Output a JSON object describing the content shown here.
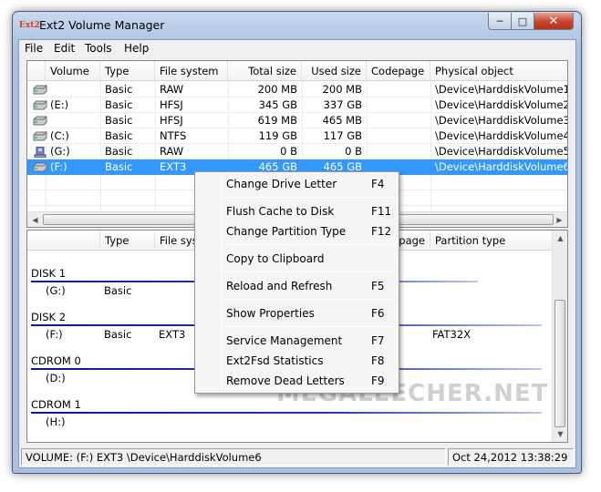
{
  "window": {
    "title": "Ext2 Volume Manager",
    "icon_text": "Ext2"
  },
  "menubar": [
    "File",
    "Edit",
    "Tools",
    "Help"
  ],
  "volume_table": {
    "columns": [
      "Volume",
      "Type",
      "File system",
      "Total size",
      "Used size",
      "Codepage",
      "Physical object"
    ],
    "rows": [
      {
        "volume": "",
        "type": "Basic",
        "fs": "RAW",
        "total": "200 MB",
        "used": "200 MB",
        "codepage": "",
        "physical": "\\Device\\HarddiskVolume1",
        "icon": "hard-drive-icon"
      },
      {
        "volume": "(E:)",
        "type": "Basic",
        "fs": "HFSJ",
        "total": "345 GB",
        "used": "337 GB",
        "codepage": "",
        "physical": "\\Device\\HarddiskVolume2",
        "icon": "hard-drive-icon"
      },
      {
        "volume": "",
        "type": "Basic",
        "fs": "HFSJ",
        "total": "619 MB",
        "used": "465 MB",
        "codepage": "",
        "physical": "\\Device\\HarddiskVolume3",
        "icon": "hard-drive-icon"
      },
      {
        "volume": "(C:)",
        "type": "Basic",
        "fs": "NTFS",
        "total": "119 GB",
        "used": "117 GB",
        "codepage": "",
        "physical": "\\Device\\HarddiskVolume4",
        "icon": "hard-drive-icon"
      },
      {
        "volume": "(G:)",
        "type": "Basic",
        "fs": "RAW",
        "total": "0 B",
        "used": "0 B",
        "codepage": "",
        "physical": "\\Device\\HarddiskVolume5",
        "icon": "usb-drive-icon"
      },
      {
        "volume": "(F:)",
        "type": "Basic",
        "fs": "EXT3",
        "total": "465 GB",
        "used": "465 GB",
        "codepage": "",
        "physical": "\\Device\\HarddiskVolume6",
        "icon": "hard-drive-icon",
        "selected": true
      }
    ]
  },
  "disk_table": {
    "columns": [
      "",
      "Type",
      "File syst",
      "",
      "",
      "page",
      "Partition type"
    ],
    "groups": [
      {
        "label": "DISK 1",
        "rows": [
          {
            "volume": "(G:)",
            "type": "Basic",
            "fs": "",
            "ptype": ""
          }
        ]
      },
      {
        "label": "DISK 2",
        "rows": [
          {
            "volume": "(F:)",
            "type": "Basic",
            "fs": "EXT3",
            "ptype": "FAT32X"
          }
        ]
      },
      {
        "label": "CDROM 0",
        "rows": [
          {
            "volume": "(D:)",
            "type": "",
            "fs": "",
            "ptype": ""
          }
        ]
      },
      {
        "label": "CDROM 1",
        "rows": [
          {
            "volume": "(H:)",
            "type": "",
            "fs": "",
            "ptype": ""
          }
        ]
      }
    ]
  },
  "context_menu": [
    {
      "label": "Change Drive Letter",
      "key": "F4"
    },
    {
      "separator": true
    },
    {
      "label": "Flush Cache to Disk",
      "key": "F11"
    },
    {
      "label": "Change Partition Type",
      "key": "F12"
    },
    {
      "separator": true
    },
    {
      "label": "Copy to Clipboard",
      "key": ""
    },
    {
      "separator": true
    },
    {
      "label": "Reload and Refresh",
      "key": "F5"
    },
    {
      "separator": true
    },
    {
      "label": "Show Properties",
      "key": "F6"
    },
    {
      "separator": true
    },
    {
      "label": "Service Management",
      "key": "F7"
    },
    {
      "label": "Ext2Fsd Statistics",
      "key": "F8"
    },
    {
      "label": "Remove Dead Letters",
      "key": "F9"
    }
  ],
  "statusbar": {
    "volume_info": "VOLUME: (F:) EXT3 \\Device\\HarddiskVolume6",
    "datetime": "Oct 24,2012 13:38:29"
  },
  "watermark": "MEGALEECHER.NET",
  "colors": {
    "selection": "#3399ff",
    "disk_line": "#0a1a8a"
  }
}
